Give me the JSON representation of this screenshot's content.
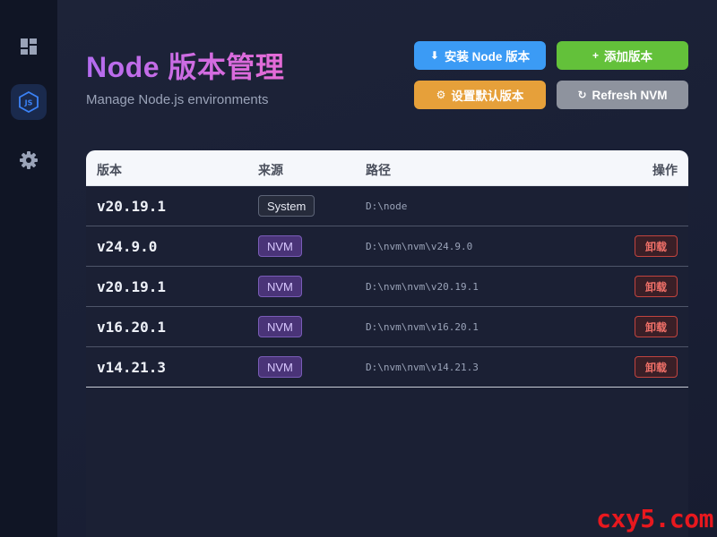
{
  "sidebar": {
    "items": [
      {
        "icon": "dashboard-icon",
        "active": false
      },
      {
        "icon": "nodejs-icon",
        "active": true
      },
      {
        "icon": "gear-icon",
        "active": false
      }
    ],
    "accent": "#3b82f6"
  },
  "header": {
    "title": "Node 版本管理",
    "subtitle": "Manage Node.js environments"
  },
  "toolbar": {
    "install_label": "安装 Node 版本",
    "add_label": "添加版本",
    "set_default_label": "设置默认版本",
    "refresh_label": "Refresh NVM",
    "colors": {
      "install": "#3b9bf5",
      "add": "#63c13a",
      "set_default": "#e6a03a",
      "refresh": "#8e939e"
    }
  },
  "table": {
    "columns": [
      "版本",
      "来源",
      "路径",
      "操作"
    ],
    "rows": [
      {
        "version": "v20.19.1",
        "source": "System",
        "path": "D:\\node",
        "action": ""
      },
      {
        "version": "v24.9.0",
        "source": "NVM",
        "path": "D:\\nvm\\nvm\\v24.9.0",
        "action": "卸载"
      },
      {
        "version": "v20.19.1",
        "source": "NVM",
        "path": "D:\\nvm\\nvm\\v20.19.1",
        "action": "卸载"
      },
      {
        "version": "v16.20.1",
        "source": "NVM",
        "path": "D:\\nvm\\nvm\\v16.20.1",
        "action": "卸载"
      },
      {
        "version": "v14.21.3",
        "source": "NVM",
        "path": "D:\\nvm\\nvm\\v14.21.3",
        "action": "卸载"
      }
    ]
  },
  "watermark": "cxy5.com"
}
